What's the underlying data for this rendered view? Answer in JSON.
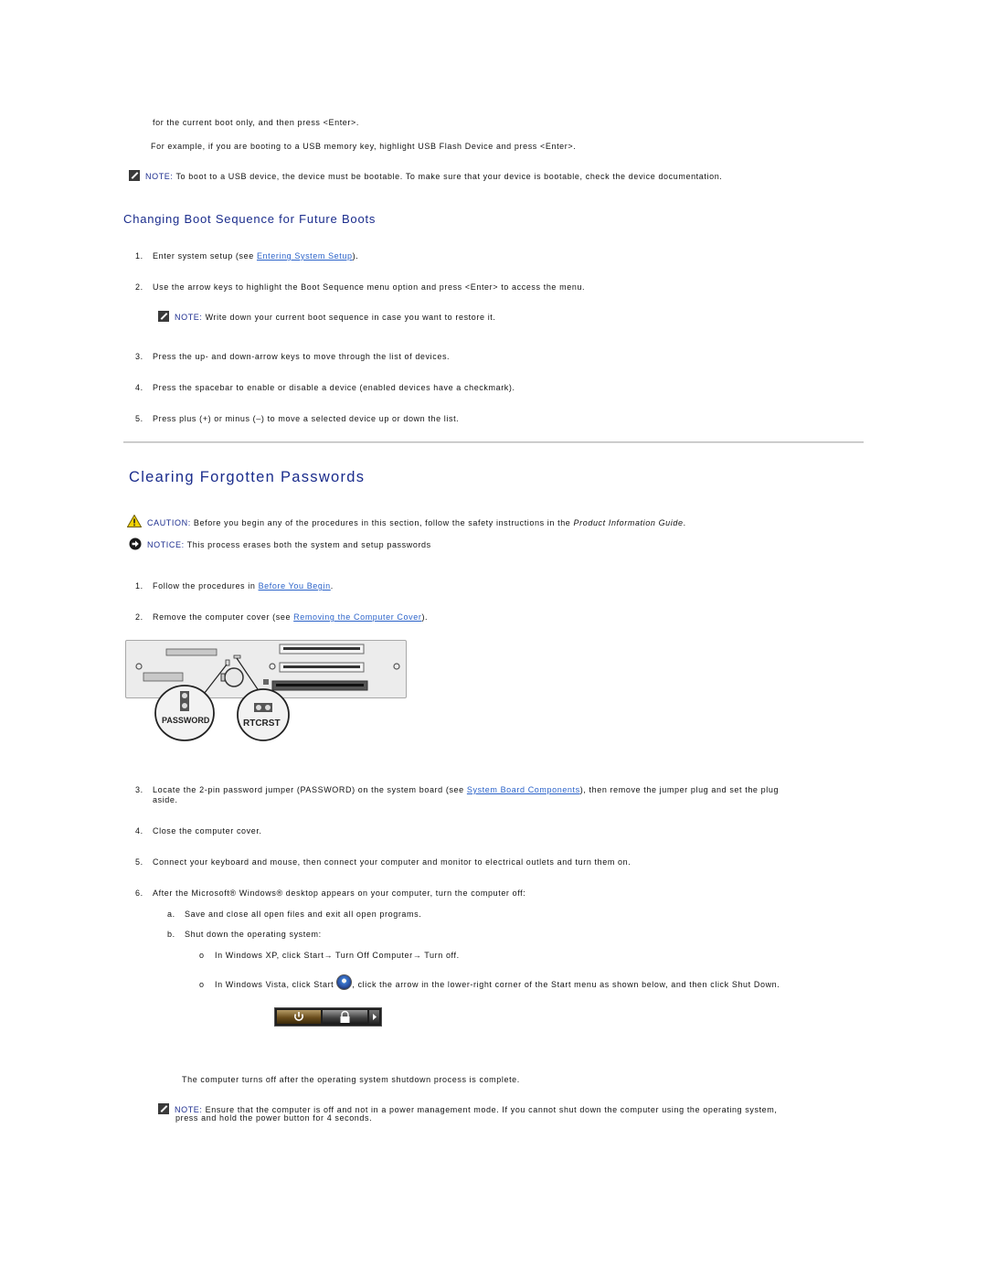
{
  "intro": {
    "line1": "for the current boot only, and then press <Enter>.",
    "line2": "For example, if you are booting to a USB memory key, highlight USB Flash Device and press <Enter>.",
    "note1": {
      "label": "NOTE:",
      "text": " To boot to a USB device, the device must be bootable. To make sure that your device is bootable, check the device documentation."
    }
  },
  "future_boots": {
    "heading": "Changing Boot Sequence for Future Boots",
    "steps": [
      {
        "num": "1.",
        "pre": "Enter system setup (see ",
        "link": "Entering System Setup",
        "post": ")."
      },
      {
        "num": "2.",
        "text": "Use the arrow keys to highlight the Boot Sequence menu option and press <Enter> to access the menu."
      },
      {
        "num": "3.",
        "text": "Press the up- and down-arrow keys to move through the list of devices."
      },
      {
        "num": "4.",
        "text": "Press the spacebar to enable or disable a device (enabled devices have a checkmark)."
      },
      {
        "num": "5.",
        "text": "Press plus (+) or minus (–) to move a selected device up or down the list."
      }
    ],
    "note": {
      "label": "NOTE:",
      "text": " Write down your current boot sequence in case you want to restore it."
    }
  },
  "clearing": {
    "heading": "Clearing Forgotten Passwords",
    "caution": {
      "label": "CAUTION:",
      "text": " Before you begin any of the procedures in this section, follow the safety instructions in the ",
      "italic": "Product Information Guide",
      "end": "."
    },
    "notice": {
      "label": "NOTICE:",
      "text": " This process erases both the system and setup passwords"
    },
    "steps": [
      {
        "num": "1.",
        "pre": "Follow the procedures in ",
        "link": "Before You Begin",
        "post": "."
      },
      {
        "num": "2.",
        "pre": "Remove the computer cover (see ",
        "link": "Removing the Computer Cover",
        "post": ")."
      },
      {
        "num": "3.",
        "pre": "Locate the 2-pin password jumper (PASSWORD) on the system board (see ",
        "link": "System Board Components",
        "post": "), then remove the jumper plug and set the plug",
        "cont": "aside."
      },
      {
        "num": "4.",
        "text": "Close the computer cover."
      },
      {
        "num": "5.",
        "text": "Connect your keyboard and mouse, then connect your computer and monitor to electrical outlets and turn them on."
      },
      {
        "num": "6.",
        "text": "After the Microsoft® Windows® desktop appears on your computer, turn the computer off:"
      }
    ],
    "substeps": [
      {
        "num": "a.",
        "text": "Save and close all open files and exit all open programs."
      },
      {
        "num": "b.",
        "text": "Shut down the operating system:"
      }
    ],
    "bullets": [
      {
        "text": "In Windows XP, click Start→ Turn Off Computer→ Turn off."
      },
      {
        "pre": "In Windows Vista, click Start ",
        "post": ", click the arrow in the lower-right corner of the Start menu as shown below, and then click Shut Down."
      }
    ],
    "diagram_labels": {
      "password": "PASSWORD",
      "rtcrst": "RTCRST"
    },
    "after_shutdown": "The computer turns off after the operating system shutdown process is complete.",
    "final_note": {
      "label": "NOTE:",
      "text": " Ensure that the computer is off and not in a power management mode. If you cannot shut down the computer using the operating system,",
      "cont": "press and hold the power button for 4 seconds."
    }
  }
}
